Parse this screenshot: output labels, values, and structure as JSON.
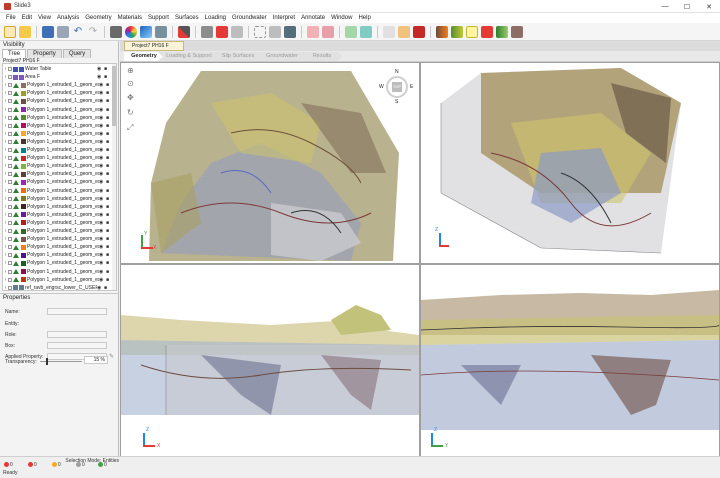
{
  "window": {
    "title": "Slide3",
    "controls": [
      "—",
      "☐",
      "✕"
    ]
  },
  "menu": [
    "File",
    "Edit",
    "View",
    "Analysis",
    "Geometry",
    "Materials",
    "Support",
    "Surfaces",
    "Loading",
    "Groundwater",
    "Interpret",
    "Annotate",
    "Window",
    "Help"
  ],
  "left_panel": {
    "visibility_header": "Visibility",
    "tabs": [
      "Tree",
      "Property",
      "Query"
    ],
    "project_label": "Project7 PH16 F",
    "tree_items": [
      {
        "label": "Water Table",
        "color": "#3f51b5",
        "kind": "water"
      },
      {
        "label": "Area F",
        "color": "#7e57c2",
        "kind": "area"
      },
      {
        "label": "Polygon 1_extruded_1_geom_exte",
        "color": "#8d6e63",
        "kind": "poly"
      },
      {
        "label": "Polygon 1_extruded_1_geom_exte",
        "color": "#9e9d24",
        "kind": "poly"
      },
      {
        "label": "Polygon 1_extruded_1_geom_exte",
        "color": "#6d4c41",
        "kind": "poly"
      },
      {
        "label": "Polygon 1_extruded_1_geom_exte",
        "color": "#8e24aa",
        "kind": "poly"
      },
      {
        "label": "Polygon 1_extruded_1_geom_exte",
        "color": "#558b2f",
        "kind": "poly"
      },
      {
        "label": "Polygon 1_extruded_1_geom_exte",
        "color": "#ad1457",
        "kind": "poly"
      },
      {
        "label": "Polygon 1_extruded_1_geom_exte",
        "color": "#f9a825",
        "kind": "poly"
      },
      {
        "label": "Polygon 1_extruded_1_geom_exte",
        "color": "#4e342e",
        "kind": "poly"
      },
      {
        "label": "Polygon 1_extruded_1_geom_exte",
        "color": "#00838f",
        "kind": "poly"
      },
      {
        "label": "Polygon 1_extruded_1_geom_exte",
        "color": "#c62828",
        "kind": "poly"
      },
      {
        "label": "Polygon 1_extruded_1_geom_exte",
        "color": "#7cb342",
        "kind": "poly"
      },
      {
        "label": "Polygon 1_extruded_1_geom_exte",
        "color": "#5d4037",
        "kind": "poly"
      },
      {
        "label": "Polygon 1_extruded_1_geom_exte",
        "color": "#9c27b0",
        "kind": "poly"
      },
      {
        "label": "Polygon 1_extruded_1_geom_exte",
        "color": "#ef6c00",
        "kind": "poly"
      },
      {
        "label": "Polygon 1_extruded_1_geom_exte",
        "color": "#827717",
        "kind": "poly"
      },
      {
        "label": "Polygon 1_extruded_1_geom_exte",
        "color": "#3e2723",
        "kind": "poly"
      },
      {
        "label": "Polygon 1_extruded_1_geom_exte",
        "color": "#6a1b9a",
        "kind": "poly"
      },
      {
        "label": "Polygon 1_extruded_1_geom_exte",
        "color": "#b71c1c",
        "kind": "poly"
      },
      {
        "label": "Polygon 1_extruded_1_geom_exte",
        "color": "#33691e",
        "kind": "poly"
      },
      {
        "label": "Polygon 1_extruded_1_geom_exte",
        "color": "#795548",
        "kind": "poly"
      },
      {
        "label": "Polygon 1_extruded_1_geom_exte",
        "color": "#f57f17",
        "kind": "poly"
      },
      {
        "label": "Polygon 1_extruded_1_geom_exte",
        "color": "#4a148c",
        "kind": "poly"
      },
      {
        "label": "Polygon 1_extruded_1_geom_exte",
        "color": "#1b5e20",
        "kind": "poly"
      },
      {
        "label": "Polygon 1_extruded_1_geom_exte",
        "color": "#880e4f",
        "kind": "poly"
      },
      {
        "label": "Polygon 1_extruded_1_geom_exte",
        "color": "#bf360c",
        "kind": "poly"
      },
      {
        "label": "ref_ravb_engrsc_lower_C_USERS_I",
        "color": "#607d8b",
        "kind": "ref"
      }
    ],
    "properties_header": "Properties",
    "props": {
      "name": "Name:",
      "entity": "Entity:",
      "role": "Role:",
      "box": "Box:",
      "applied": "Applied Property:",
      "transparency": "Transparency:",
      "transparency_value": "15 %",
      "transparency_level_pct": 15
    }
  },
  "document": {
    "tab_label": "Project7 PH16 F",
    "workflow_tabs": [
      "Geometry",
      "Loading & Support",
      "Slip Surfaces",
      "Groundwater",
      "Results"
    ],
    "active_workflow": "Geometry"
  },
  "viewport": {
    "compass": {
      "n": "N",
      "s": "S",
      "e": "E",
      "w": "W",
      "center": "TOP"
    },
    "axis_labels": {
      "x": "X",
      "y": "Y",
      "z": "Z"
    }
  },
  "status": {
    "selection_mode": "Selection Mode: Entities",
    "ready": "Ready",
    "counts": [
      {
        "value": "0",
        "color": "#e53935"
      },
      {
        "value": "0",
        "color": "#e53935"
      },
      {
        "value": "0",
        "color": "#f9a825"
      },
      {
        "value": "0",
        "color": "#9e9e9e"
      },
      {
        "value": "0",
        "color": "#43a047"
      }
    ]
  }
}
